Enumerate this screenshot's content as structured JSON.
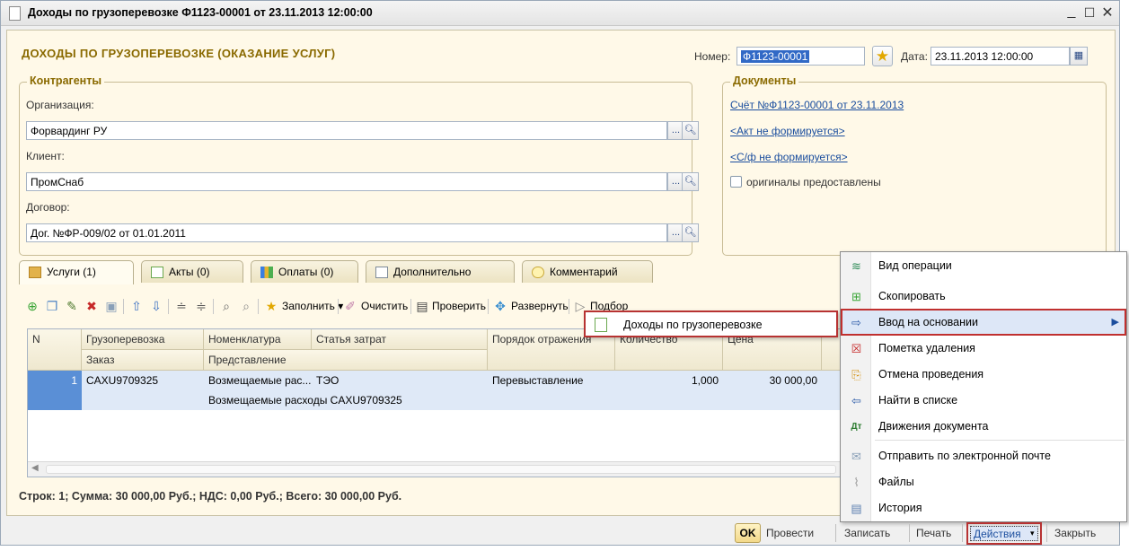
{
  "window": {
    "title": "Доходы по грузоперевозке Ф1123-00001 от 23.11.2013 12:00:00"
  },
  "header": {
    "doc_title": "ДОХОДЫ ПО ГРУЗОПЕРЕВОЗКЕ (ОКАЗАНИЕ УСЛУГ)",
    "number_label": "Номер:",
    "number_value": "Ф1123-00001",
    "date_label": "Дата:",
    "date_value": "23.11.2013 12:00:00"
  },
  "counterparties": {
    "group_title": "Контрагенты",
    "org_label": "Организация:",
    "org_value": "Форвардинг РУ",
    "client_label": "Клиент:",
    "client_value": "ПромСнаб",
    "contract_label": "Договор:",
    "contract_value": "Дог. №ФР-009/02 от 01.01.2011",
    "select_btn": "...",
    "search_icon": "search-icon"
  },
  "documents": {
    "group_title": "Документы",
    "invoice_link": "Счёт №Ф1123-00001 от 23.11.2013",
    "act_link": "<Акт не формируется>",
    "sf_link": "<С/ф не формируется>",
    "originals_label": "оригиналы предоставлены"
  },
  "tabs": [
    {
      "label": "Услуги (1)",
      "icon": "table-icon"
    },
    {
      "label": "Акты (0)",
      "icon": "document-icon"
    },
    {
      "label": "Оплаты (0)",
      "icon": "bar-chart-icon"
    },
    {
      "label": "Дополнительно",
      "icon": "page-icon"
    },
    {
      "label": "Комментарий",
      "icon": "speech-bubble-icon"
    }
  ],
  "toolbar": {
    "fill_label": "Заполнить",
    "clear_label": "Очистить",
    "check_label": "Проверить",
    "expand_label": "Развернуть",
    "pick_label": "Подбор"
  },
  "grid": {
    "headers_row1": [
      "N",
      "Грузоперевозка",
      "Номенклатура",
      "Статья затрат",
      "Порядок отражения",
      "Количество",
      "Цена"
    ],
    "headers_row2": [
      "Заказ",
      "Представление"
    ],
    "rows": [
      {
        "n": "1",
        "cargo": "CAXU9709325",
        "nomenclature": "Возмещаемые рас...",
        "cost_item": "ТЭО",
        "reflection": "Перевыставление",
        "quantity": "1,000",
        "price": "30 000,00",
        "representation": "Возмещаемые расходы CAXU9709325"
      }
    ]
  },
  "summary": "Строк: 1;  Сумма: 30 000,00 Руб.;  НДС: 0,00 Руб.;  Всего: 30 000,00 Руб.",
  "submenu": {
    "item": "Доходы по грузоперевозке"
  },
  "actions_menu": {
    "items": [
      {
        "label": "Вид операции",
        "icon": "layers-icon"
      },
      {
        "label": "Скопировать",
        "icon": "copy-icon"
      },
      {
        "label": "Ввод на основании",
        "icon": "enter-based-icon",
        "highlighted": true
      },
      {
        "label": "Пометка удаления",
        "icon": "delete-mark-icon"
      },
      {
        "label": "Отмена проведения",
        "icon": "cancel-posting-icon"
      },
      {
        "label": "Найти в списке",
        "icon": "find-in-list-icon"
      },
      {
        "label": "Движения документа",
        "icon": "debit-credit-icon"
      },
      {
        "label": "Отправить по электронной почте",
        "icon": "email-icon"
      },
      {
        "label": "Файлы",
        "icon": "paperclip-icon"
      },
      {
        "label": "История",
        "icon": "history-icon"
      }
    ]
  },
  "bottom_bar": {
    "ok": "OK",
    "post": "Провести",
    "save": "Записать",
    "print": "Печать",
    "actions": "Действия",
    "close": "Закрыть"
  },
  "colors": {
    "accent_heading": "#8a6a00",
    "link": "#1b4e9e",
    "selection": "#3169c6",
    "highlight_border": "#c0302f"
  }
}
